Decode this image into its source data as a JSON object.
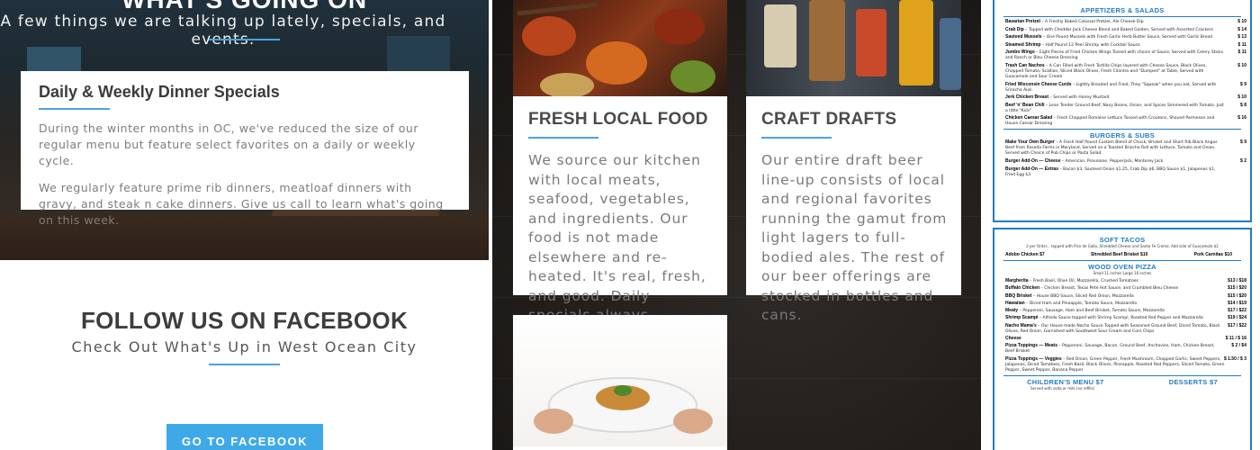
{
  "hero": {
    "title": "WHAT'S GOING ON",
    "subtitle": "A few things we are talking up lately, specials, and events."
  },
  "specials_card": {
    "heading": "Daily & Weekly Dinner Specials",
    "para1": "During the winter months in OC, we've reduced the size of our regular menu but feature select favorites on a daily or weekly cycle.",
    "para2": "We regularly feature prime rib dinners, meatloaf dinners with gravy, and steak n cake dinners. Give us call to learn what's going on this week."
  },
  "follow": {
    "title": "FOLLOW US ON FACEBOOK",
    "subtitle": "Check Out What's Up in West Ocean City",
    "button_label": "GO TO FACEBOOK"
  },
  "tiles": {
    "food": {
      "heading": "FRESH LOCAL FOOD",
      "body": "We source our kitchen with local meats, seafood, vegetables, and ingredients. Our food is not made elsewhere and re-heated. It's real, fresh, and good. Daily specials always available."
    },
    "drafts": {
      "heading": "CRAFT DRAFTS",
      "body": "Our entire draft beer line-up consists of local and regional favorites running the gamut from light lagers to full-bodied ales. The rest of our beer offerings are stocked in bottles and cans."
    }
  },
  "menu": {
    "appetizers_title": "APPETIZERS & SALADS",
    "appetizers": [
      {
        "name": "Bavarian Pretzel",
        "desc": "A Freshly Baked Colossal Pretzel, Ale Cheese Dip",
        "price": "$ 10"
      },
      {
        "name": "Crab Dip",
        "desc": "Topped with Cheddar Jack Cheese Blend and Baked Golden, Served with Assorted Crackers",
        "price": "$ 14"
      },
      {
        "name": "Sauteed Mussels",
        "desc": "One Pound Mussels with Fresh Garlic Herb Butter Sauce, Served with Garlic Bread",
        "price": "$ 13"
      },
      {
        "name": "Steamed Shrimp",
        "desc": "Half Pound 12 Peel Shrimp with Cocktail Sauce",
        "price": "$ 11"
      },
      {
        "name": "Jumbo Wings",
        "desc": "Eight Pieces of Fried Chicken Wings Tossed with choice of Sauce, Served with Celery Sticks and Ranch or Bleu Cheese Dressing",
        "price": "$ 11"
      },
      {
        "name": "Trash Can Nachos",
        "desc": "A Can Filled with Fresh Tortilla Chips layered with Cheese Sauce, Black Olives, Chopped Tomato, Scallion, Sliced Black Olives, Fresh Cilantro and \"Dumped\" at Table, Served with Guacamole and Sour Cream",
        "price": "$ 10"
      },
      {
        "name": "Fried Wisconsin Cheese Curds",
        "desc": "Lightly Breaded and Fried, They \"Squeak\" when you eat, Served with Sriracha Aioli",
        "price": "$ 9"
      },
      {
        "name": "Jerk Chicken Breast",
        "desc": "Served with Honey Mustard",
        "price": "$ 10"
      },
      {
        "name": "Beef 'n' Bean Chili",
        "desc": "Lean Tender Ground Beef, Navy Beans, Onion, and Spices Simmered with Tomato. Just a little \"Kick\"",
        "price": "$ 8"
      },
      {
        "name": "Chicken Caesar Salad",
        "desc": "Fresh Chopped Romaine Lettuce Tossed with Croutons, Shaved Parmesan and House Caesar Dressing",
        "price": "$ 16"
      }
    ],
    "burgers_title": "BURGERS & SUBS",
    "burgers": [
      {
        "name": "Make Your Own Burger",
        "desc": "A Fresh Half Pound Custom Blend of Chuck, Brisket and Short Rib Black Angus Beef from Roseda Farms in Maryland, Served on a Toasted Brioche Roll with Lettuce, Tomato and Onion. Served with Choice of Pub Chips or Pasta Salad.",
        "price": "$ 9"
      },
      {
        "name": "Burger Add-On — Cheese",
        "desc": "American, Provolone, Pepperjack, Monterey Jack",
        "price": "$ 2"
      },
      {
        "name": "Burger Add-On — Extras",
        "desc": "Bacon $3, Sauteed Onion $1.25, Crab Dip $6, BBQ Sauce $1, Jalapenos $1, Fried Egg $3",
        "price": ""
      }
    ],
    "tacos_title": "SOFT TACOS",
    "tacos_note": "2 per Order... topped with Pico de Gallo, Shredded Cheese and Santa Fe Crema. Add side of Guacamole $2",
    "tacos": [
      {
        "name": "Adobo Chicken",
        "price": "$7"
      },
      {
        "name": "Shredded Beef Brisket",
        "price": "$10"
      },
      {
        "name": "Pork Carnitas",
        "price": "$10"
      }
    ],
    "pizza_title": "WOOD OVEN PIZZA",
    "pizza_note": "Small 11 inches Large 16 inches",
    "pizzas": [
      {
        "name": "Margherita",
        "desc": "Fresh Basil, Olive Oil, Mozzarella, Crushed Tomatoes",
        "price": "$13 / $18"
      },
      {
        "name": "Buffalo Chicken",
        "desc": "Chicken Breast, Texas Pete Hot Sauce, and Crumbled Bleu Cheese",
        "price": "$15 / $20"
      },
      {
        "name": "BBQ Brisket",
        "desc": "House BBQ Sauce, Sliced Red Onion, Mozzarella",
        "price": "$15 / $20"
      },
      {
        "name": "Hawaiian",
        "desc": "Diced Ham and Pineapple, Tomato Sauce, Mozzarella",
        "price": "$14 / $19"
      },
      {
        "name": "Meaty",
        "desc": "Pepperoni, Sausage, Ham and Beef Brisket, Tomato Sauce, Mozzarella",
        "price": "$17 / $22"
      },
      {
        "name": "Shrimp Scampi",
        "desc": "Alfredo Sauce topped with Shrimp Scampi, Roasted Red Pepper and Mozzarella",
        "price": "$19 / $24"
      },
      {
        "name": "Nacho Mama's",
        "desc": "Our House made Nacho Sauce Topped with Seasoned Ground Beef, Diced Tomato, Black Olives, Red Onion. Garnished with Southwest Sour Cream and Corn Chips",
        "price": "$17 / $22"
      },
      {
        "name": "Cheese",
        "desc": "",
        "price": "$ 11 / $ 16"
      },
      {
        "name": "Pizza Toppings — Meats",
        "desc": "Pepperoni, Sausage, Bacon, Ground Beef, Anchovies, Ham, Chicken Breast, Beef Brisket",
        "price": "$ 2 / $4"
      },
      {
        "name": "Pizza Toppings — Veggies",
        "desc": "Red Onion, Green Pepper, Fresh Mushroom, Chopped Garlic, Sweet Peppers, Jalapenos, Diced Tomatoes, Fresh Basil, Black Olives, Pineapple, Roasted Red Peppers, Sliced Tomato, Green Pepper, Sweet Pepper, Banana Pepper",
        "price": "$ 1.50 / $ 3"
      }
    ],
    "kids_title": "CHILDREN'S MENU $7",
    "kids_note": "Served with soda or milk (no refills)",
    "desserts_title": "DESSERTS $7"
  }
}
